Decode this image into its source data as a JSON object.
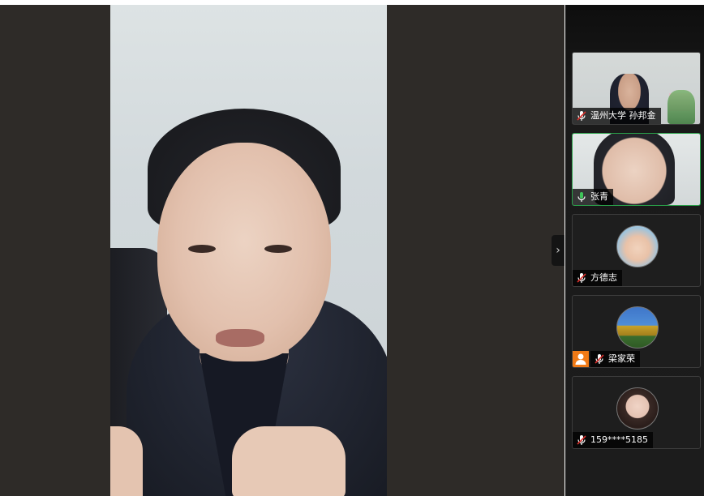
{
  "participants": [
    {
      "name": "温州大学 孙邦金",
      "mic": "muted",
      "video": "camera"
    },
    {
      "name": "张青",
      "mic": "active",
      "video": "camera",
      "active_speaker": true
    },
    {
      "name": "方德志",
      "mic": "muted",
      "video": "avatar",
      "avatar": "child-photo"
    },
    {
      "name": "梁家荣",
      "mic": "muted",
      "video": "avatar",
      "avatar": "house-photo",
      "host": true
    },
    {
      "name": "159****5185",
      "mic": "muted",
      "video": "avatar",
      "avatar": "woman-photo"
    }
  ],
  "toggle_icon": "chevron-right-icon",
  "colors": {
    "stage_bg": "#2e2b28",
    "sidebar_bg": "#1c1c1c",
    "active_border": "#2aa24a",
    "host_badge": "#f07a16",
    "muted_mic": "#d9302c",
    "active_mic": "#3fc45a"
  }
}
